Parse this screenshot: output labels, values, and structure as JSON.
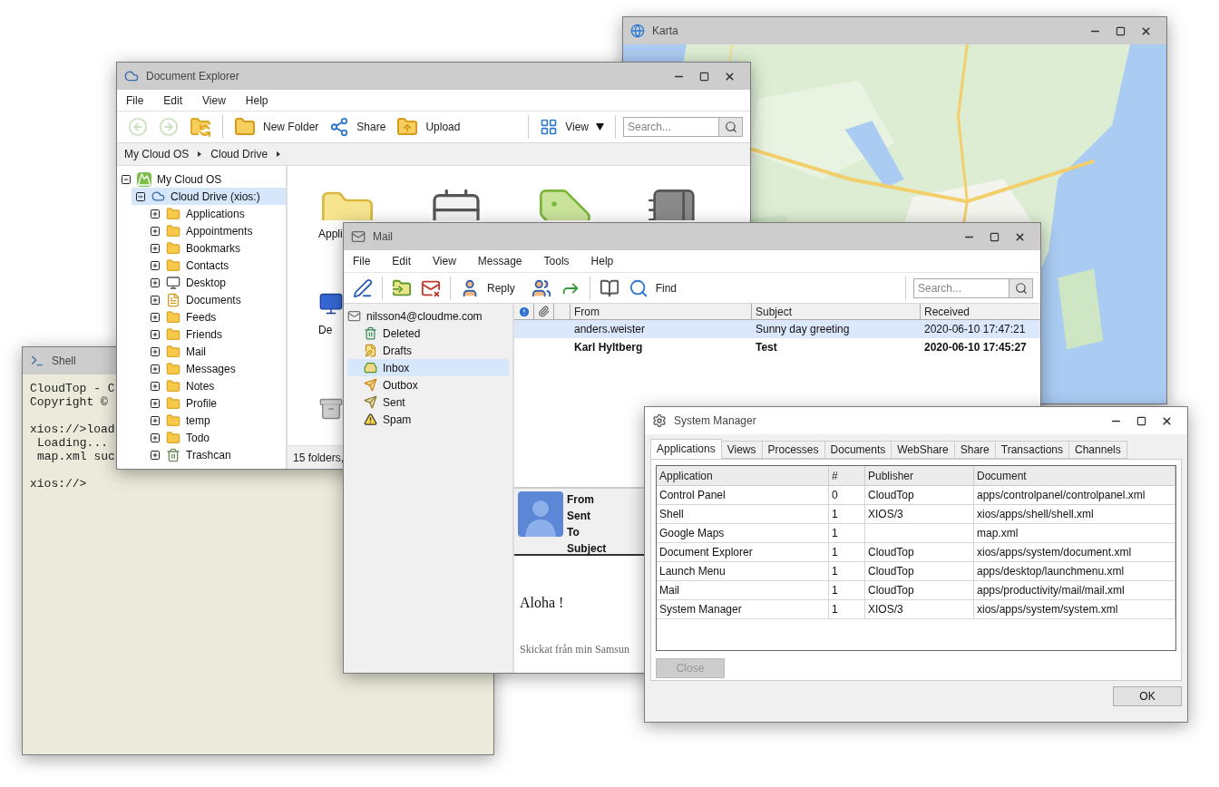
{
  "windows": [
    {
      "kind": "map",
      "title": "Karta",
      "active": false
    },
    {
      "kind": "shell",
      "title": "Shell",
      "active": false,
      "blocks": [
        [
          {
            "text": "CloudTop - C",
            "indented": false
          },
          {
            "text": "Copyright ©",
            "indented": false
          }
        ],
        [
          {
            "text": "xios://>load",
            "indented": false
          },
          {
            "text": "Loading...",
            "indented": true
          },
          {
            "text": "map.xml suc",
            "indented": true
          }
        ],
        [
          {
            "text": "xios://>",
            "indented": false
          }
        ]
      ]
    },
    {
      "kind": "explorer",
      "title": "Document Explorer",
      "active": false,
      "menu": [
        "File",
        "Edit",
        "View",
        "Help"
      ],
      "toolbar": [
        {
          "kind": "back",
          "disabled": true
        },
        {
          "kind": "forward",
          "disabled": true
        },
        {
          "kind": "refresh",
          "disabled": false
        },
        {
          "kind": "new-folder",
          "label": "New Folder",
          "disabled": false
        },
        {
          "kind": "share",
          "label": "Share",
          "disabled": false
        },
        {
          "kind": "upload",
          "label": "Upload",
          "disabled": false
        }
      ],
      "view_button": "View",
      "search": {
        "placeholder": "Search..."
      },
      "breadcrumb": [
        "My Cloud OS",
        "Cloud Drive"
      ],
      "tree": [
        {
          "label": "My Cloud OS",
          "kind": "root",
          "expanded": true,
          "selected": false,
          "children": [
            {
              "label": "Cloud Drive (xios:)",
              "kind": "drive",
              "expanded": true,
              "selected": true,
              "children": [
                {
                  "label": "Applications",
                  "kind": "folder",
                  "expanded": false,
                  "selected": false
                },
                {
                  "label": "Appointments",
                  "kind": "folder",
                  "expanded": false,
                  "selected": false
                },
                {
                  "label": "Bookmarks",
                  "kind": "folder",
                  "expanded": false,
                  "selected": false
                },
                {
                  "label": "Contacts",
                  "kind": "folder",
                  "expanded": false,
                  "selected": false
                },
                {
                  "label": "Desktop",
                  "kind": "desktop",
                  "expanded": false,
                  "selected": false
                },
                {
                  "label": "Documents",
                  "kind": "documents",
                  "expanded": false,
                  "selected": false
                },
                {
                  "label": "Feeds",
                  "kind": "folder",
                  "expanded": false,
                  "selected": false
                },
                {
                  "label": "Friends",
                  "kind": "folder",
                  "expanded": false,
                  "selected": false
                },
                {
                  "label": "Mail",
                  "kind": "folder",
                  "expanded": false,
                  "selected": false
                },
                {
                  "label": "Messages",
                  "kind": "folder",
                  "expanded": false,
                  "selected": false
                },
                {
                  "label": "Notes",
                  "kind": "folder",
                  "expanded": false,
                  "selected": false
                },
                {
                  "label": "Profile",
                  "kind": "folder",
                  "expanded": false,
                  "selected": false
                },
                {
                  "label": "temp",
                  "kind": "folder",
                  "expanded": false,
                  "selected": false
                },
                {
                  "label": "Todo",
                  "kind": "folder",
                  "expanded": false,
                  "selected": false
                },
                {
                  "label": "Trashcan",
                  "kind": "trash",
                  "expanded": false,
                  "selected": false
                }
              ]
            }
          ]
        }
      ],
      "icon_rows": [
        [
          {
            "kind": "folder",
            "label": "Appli"
          },
          {
            "kind": "calendar"
          },
          {
            "kind": "tag-folder"
          },
          {
            "kind": "notebook"
          }
        ],
        [
          {
            "kind": "monitor",
            "label": "De"
          }
        ],
        [
          {
            "kind": "arch"
          }
        ]
      ],
      "status": "15 folders,"
    },
    {
      "kind": "mail",
      "title": "Mail",
      "active": false,
      "menu": [
        "File",
        "Edit",
        "View",
        "Message",
        "Tools",
        "Help"
      ],
      "toolbar": [
        {
          "kind": "compose"
        },
        {
          "kind": "move"
        },
        {
          "kind": "delete"
        },
        {
          "kind": "reply",
          "label": "Reply"
        },
        {
          "kind": "reply-all"
        },
        {
          "kind": "forward"
        },
        {
          "kind": "address-book"
        },
        {
          "kind": "find",
          "label": "Find"
        }
      ],
      "search": {
        "placeholder": "Search..."
      },
      "account": "nilsson4@cloudme.com",
      "folders": [
        {
          "label": "Deleted",
          "kind": "deleted",
          "selected": false
        },
        {
          "label": "Drafts",
          "kind": "drafts",
          "selected": false
        },
        {
          "label": "Inbox",
          "kind": "inbox",
          "selected": true
        },
        {
          "label": "Outbox",
          "kind": "outbox",
          "selected": false
        },
        {
          "label": "Sent",
          "kind": "sent",
          "selected": false
        },
        {
          "label": "Spam",
          "kind": "spam",
          "selected": false
        }
      ],
      "columns": [
        "From",
        "Subject",
        "Received"
      ],
      "messages": [
        {
          "from": "anders.weister",
          "subject": "Sunny day greeting",
          "received": "2020-06-10 17:47:21",
          "unread": false,
          "selected": true
        },
        {
          "from": "Karl Hyltberg",
          "subject": "Test",
          "received": "2020-06-10 17:45:27",
          "unread": true,
          "selected": false
        }
      ],
      "preview_fields": [
        "From",
        "Sent",
        "To",
        "Subject"
      ],
      "preview_body": [
        "Aloha !",
        "Skickat från min Samsun"
      ]
    },
    {
      "kind": "system",
      "title": "System Manager",
      "active": true,
      "tabs": [
        {
          "label": "Applications",
          "selected": true
        },
        {
          "label": "Views",
          "selected": false
        },
        {
          "label": "Processes",
          "selected": false
        },
        {
          "label": "Documents",
          "selected": false
        },
        {
          "label": "WebShare",
          "selected": false
        },
        {
          "label": "Share",
          "selected": false
        },
        {
          "label": "Transactions",
          "selected": false
        },
        {
          "label": "Channels",
          "selected": false
        }
      ],
      "columns": [
        "Application",
        "#",
        "Publisher",
        "Document"
      ],
      "rows": [
        [
          "Control Panel",
          "0",
          "CloudTop",
          "apps/controlpanel/controlpanel.xml"
        ],
        [
          "Shell",
          "1",
          "XIOS/3",
          "xios/apps/shell/shell.xml"
        ],
        [
          "Google Maps",
          "1",
          "",
          "map.xml"
        ],
        [
          "Document Explorer",
          "1",
          "CloudTop",
          "xios/apps/system/document.xml"
        ],
        [
          "Launch Menu",
          "1",
          "CloudTop",
          "apps/desktop/launchmenu.xml"
        ],
        [
          "Mail",
          "1",
          "CloudTop",
          "apps/productivity/mail/mail.xml"
        ],
        [
          "System Manager",
          "1",
          "XIOS/3",
          "xios/apps/system/system.xml"
        ]
      ],
      "close_button": {
        "label": "Close",
        "disabled": true
      },
      "ok_button": "OK"
    }
  ]
}
